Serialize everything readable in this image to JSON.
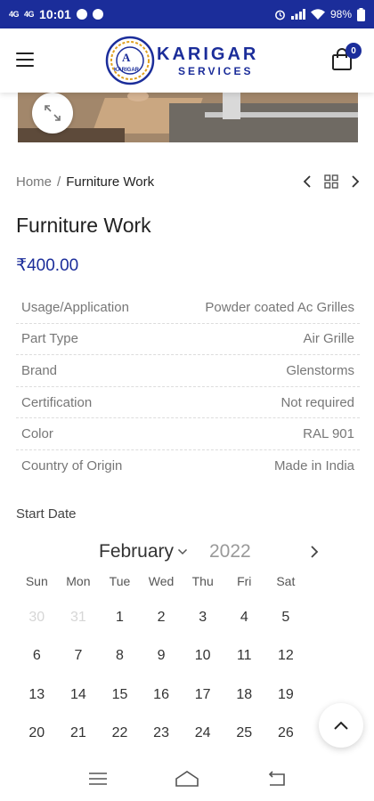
{
  "status_bar": {
    "signal_left": "4G",
    "signal_right": "4G",
    "time": "10:01",
    "battery": "98%"
  },
  "header": {
    "logo_primary": "KARIGAR",
    "logo_secondary": "SERVICES",
    "logo_badge": "A",
    "logo_badge_sub": "KARIGAR",
    "cart_count": "0"
  },
  "breadcrumb": {
    "home": "Home",
    "separator": "/",
    "current": "Furniture Work"
  },
  "product": {
    "title": "Furniture Work",
    "price": "₹400.00"
  },
  "attributes": [
    {
      "label": "Usage/Application",
      "value": "Powder coated Ac Grilles"
    },
    {
      "label": "Part Type",
      "value": "Air Grille"
    },
    {
      "label": "Brand",
      "value": "Glenstorms"
    },
    {
      "label": "Certification",
      "value": "Not required"
    },
    {
      "label": "Color",
      "value": "RAL 901"
    },
    {
      "label": "Country of Origin",
      "value": "Made in India"
    }
  ],
  "calendar": {
    "label": "Start Date",
    "month": "February",
    "year": "2022",
    "weekdays": [
      "Sun",
      "Mon",
      "Tue",
      "Wed",
      "Thu",
      "Fri",
      "Sat"
    ],
    "days": [
      {
        "d": "30",
        "muted": true
      },
      {
        "d": "31",
        "muted": true
      },
      {
        "d": "1"
      },
      {
        "d": "2"
      },
      {
        "d": "3"
      },
      {
        "d": "4"
      },
      {
        "d": "5"
      },
      {
        "d": "6"
      },
      {
        "d": "7"
      },
      {
        "d": "8"
      },
      {
        "d": "9"
      },
      {
        "d": "10"
      },
      {
        "d": "11"
      },
      {
        "d": "12"
      },
      {
        "d": "13"
      },
      {
        "d": "14"
      },
      {
        "d": "15"
      },
      {
        "d": "16"
      },
      {
        "d": "17"
      },
      {
        "d": "18"
      },
      {
        "d": "19"
      },
      {
        "d": "20"
      },
      {
        "d": "21"
      },
      {
        "d": "22"
      },
      {
        "d": "23"
      },
      {
        "d": "24"
      },
      {
        "d": "25"
      },
      {
        "d": "26"
      }
    ]
  },
  "colors": {
    "brand_blue": "#1b2d9a",
    "muted_text": "#777777"
  }
}
